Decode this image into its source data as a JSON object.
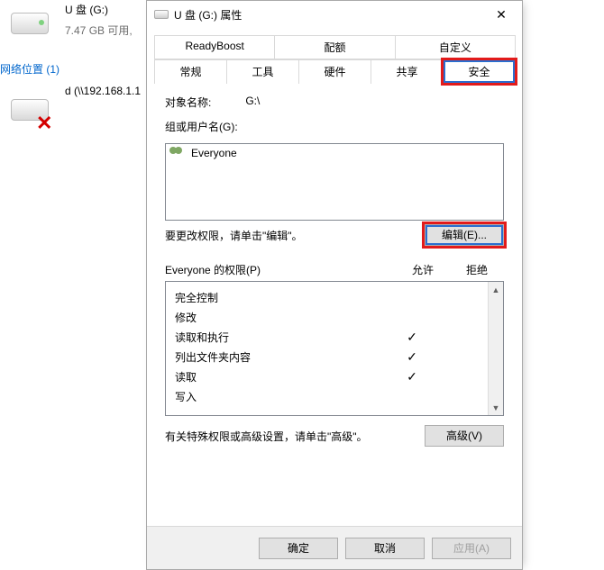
{
  "explorer": {
    "drive_label": "U 盘 (G:)",
    "drive_sub": "7.47 GB 可用,",
    "net_header": "网络位置 (1)",
    "net_item": "d (\\\\192.168.1.1"
  },
  "dialog": {
    "title": "U 盘 (G:) 属性",
    "tabs_row1": [
      "ReadyBoost",
      "配额",
      "自定义"
    ],
    "tabs_row2": [
      "常规",
      "工具",
      "硬件",
      "共享",
      "安全"
    ],
    "active_tab_idx": 4,
    "obj_label": "对象名称:",
    "obj_value": "G:\\",
    "groups_label": "组或用户名(G):",
    "group_item": "Everyone",
    "edit_hint": "要更改权限，请单击\"编辑\"。",
    "edit_btn": "编辑(E)...",
    "perm_header": "Everyone 的权限(P)",
    "col_allow": "允许",
    "col_deny": "拒绝",
    "perms": [
      {
        "name": "完全控制",
        "allow": false
      },
      {
        "name": "修改",
        "allow": false
      },
      {
        "name": "读取和执行",
        "allow": true
      },
      {
        "name": "列出文件夹内容",
        "allow": true
      },
      {
        "name": "读取",
        "allow": true
      },
      {
        "name": "写入",
        "allow": false
      }
    ],
    "adv_hint": "有关特殊权限或高级设置，请单击\"高级\"。",
    "adv_btn": "高级(V)",
    "ok": "确定",
    "cancel": "取消",
    "apply": "应用(A)"
  }
}
